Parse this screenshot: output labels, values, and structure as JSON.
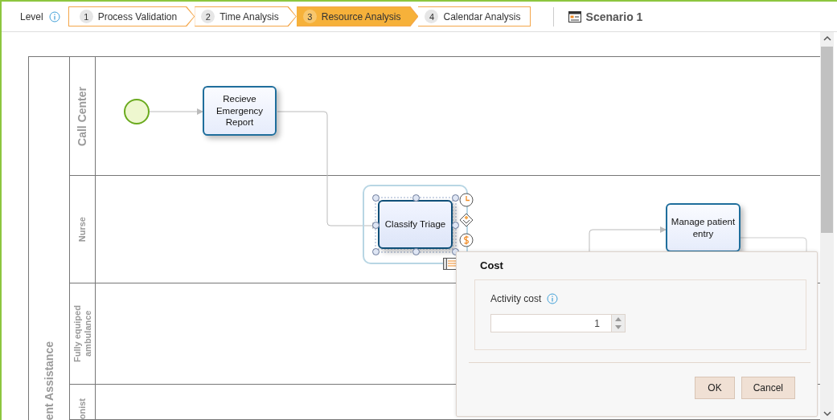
{
  "toolbar": {
    "level_label": "Level",
    "steps": [
      {
        "number": "1",
        "label": "Process Validation",
        "selected": false
      },
      {
        "number": "2",
        "label": "Time Analysis",
        "selected": false
      },
      {
        "number": "3",
        "label": "Resource Analysis",
        "selected": true
      },
      {
        "number": "4",
        "label": "Calendar Analysis",
        "selected": false
      }
    ],
    "scenario": "Scenario 1"
  },
  "diagram": {
    "pool": {
      "title": "ent Assistance"
    },
    "lanes": [
      {
        "name": "Call Center"
      },
      {
        "name": "Nurse"
      },
      {
        "name": "Fully equiped ambulance"
      },
      {
        "name": "onist"
      }
    ],
    "tasks": [
      {
        "label": "Recieve Emergency Report",
        "selected": false
      },
      {
        "label": "Classify Triage",
        "selected": true
      },
      {
        "label": "Manage patient entry",
        "selected": false
      }
    ]
  },
  "dialog": {
    "title": "Cost",
    "field_label": "Activity cost",
    "value": "1",
    "buttons": [
      "OK",
      "Cancel"
    ]
  }
}
